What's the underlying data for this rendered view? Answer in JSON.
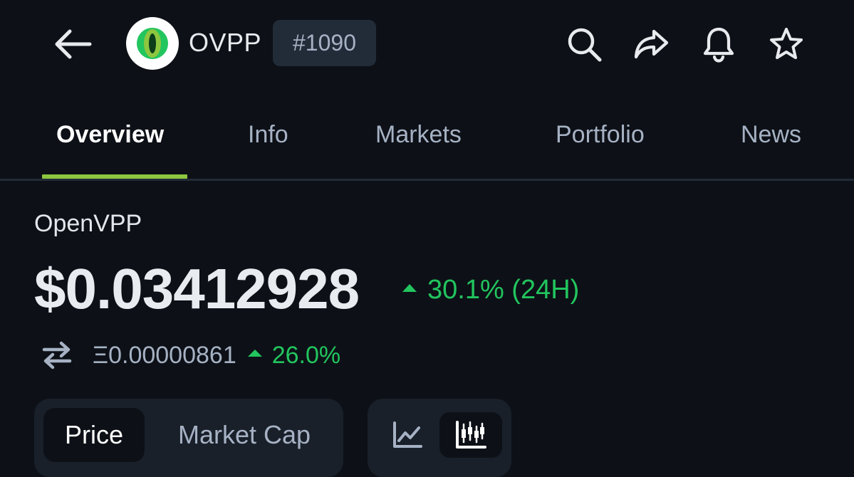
{
  "header": {
    "coin_symbol": "OVPP",
    "rank": "#1090",
    "icons": {
      "back": "arrow-left-icon",
      "search": "search-icon",
      "share": "share-icon",
      "alert": "bell-icon",
      "favorite": "star-icon",
      "logo": "openvpp-logo"
    }
  },
  "tabs": [
    {
      "label": "Overview",
      "active": true
    },
    {
      "label": "Info",
      "active": false
    },
    {
      "label": "Markets",
      "active": false
    },
    {
      "label": "Portfolio",
      "active": false
    },
    {
      "label": "News",
      "active": false
    }
  ],
  "coin": {
    "name": "OpenVPP",
    "price": "$0.03412928",
    "change_24h": "30.1% (24H)",
    "eth_price": "Ξ0.00000861",
    "eth_change": "26.0%",
    "swap_icon": "swap-arrows-icon"
  },
  "metric_toggle": {
    "options": [
      "Price",
      "Market Cap"
    ],
    "selected": "Price"
  },
  "chart_toggle": {
    "options": [
      "line-chart-icon",
      "candlestick-chart-icon"
    ],
    "selected": "candlestick-chart-icon"
  },
  "colors": {
    "background": "#0d1117",
    "accent": "#8dc63f",
    "positive": "#22c55e",
    "muted_text": "#a6b2c4",
    "badge_bg": "#222b38"
  }
}
